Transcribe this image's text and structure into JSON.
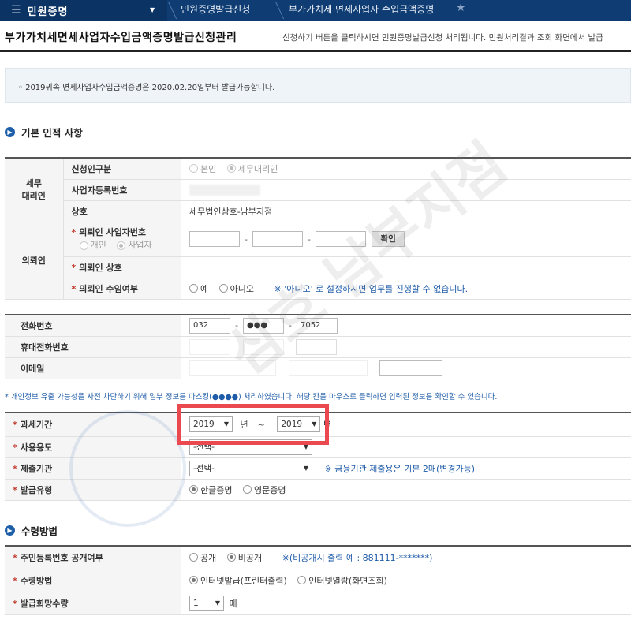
{
  "topbar": {
    "menu_label": "민원증명",
    "breadcrumbs": [
      "민원증명발급신청",
      "부가가치세 면세사업자 수입금액증명"
    ]
  },
  "header": {
    "title": "부가가치세면세사업자수입금액증명발급신청관리",
    "description": "신청하기 버튼을 클릭하시면 민원증명발급신청 처리됩니다. 민원처리결과 조회 화면에서 발급"
  },
  "notice": "◦ 2019귀속 면세사업자수입금액증명은 2020.02.20일부터 발급가능합니다.",
  "section1": {
    "title": "기본 인적 사항",
    "agent_group": "세무\n대리인",
    "applicant_type_label": "신청인구분",
    "applicant_type_options": [
      "본인",
      "세무대리인"
    ],
    "biz_no_label": "사업자등록번호",
    "company_label": "상호",
    "company_value": "세무법인삼호-남부지점",
    "client_group": "의뢰인",
    "client_biz_label": "의뢰인 사업자번호",
    "client_kind_options": [
      "개인",
      "사업자"
    ],
    "confirm_button": "확인",
    "client_name_label": "의뢰인 상호",
    "client_consent_label": "의뢰인 수임여부",
    "consent_options": [
      "예",
      "아니오"
    ],
    "consent_hint": "※ '아니오' 로 설정하시면 업무를 진행할 수 없습니다.",
    "phone_label": "전화번호",
    "phone": [
      "032",
      "●●●",
      "7052"
    ],
    "mobile_label": "휴대전화번호",
    "email_label": "이메일"
  },
  "privacy_note": "* 개인정보 유출 가능성을 사전 차단하기 위해 일부 정보를 마스킹(●●●●) 처리하였습니다. 해당 칸을 마우스로 클릭하면 입력된 정보를 확인할 수 있습니다.",
  "period": {
    "label": "과세기간",
    "from_year": "2019",
    "to_year": "2019",
    "year_unit": "년",
    "tilde": "~"
  },
  "usage": {
    "label": "사용용도",
    "value": "-선택-"
  },
  "submit_org": {
    "label": "제출기관",
    "value": "-선택-",
    "hint": "※ 금융기관 제출용은 기본 2매(변경가능)"
  },
  "issue_type": {
    "label": "발급유형",
    "options": [
      "한글증명",
      "영문증명"
    ]
  },
  "section2": {
    "title": "수령방법",
    "rrn_label": "주민등록번호 공개여부",
    "rrn_options": [
      "공개",
      "비공개"
    ],
    "rrn_hint": "※(비공개시 출력 예 : 881111-*******)",
    "method_label": "수령방법",
    "method_options": [
      "인터넷발급(프린터출력)",
      "인터넷열람(화면조회)"
    ],
    "qty_label": "발급희망수량",
    "qty_value": "1",
    "qty_unit": "매"
  },
  "watermark": "삼호 남부지점",
  "colors": {
    "topbar": "#0f3d73",
    "accent": "#1e5ba8",
    "highlight": "#ea4a4f",
    "required": "#c0392b"
  }
}
